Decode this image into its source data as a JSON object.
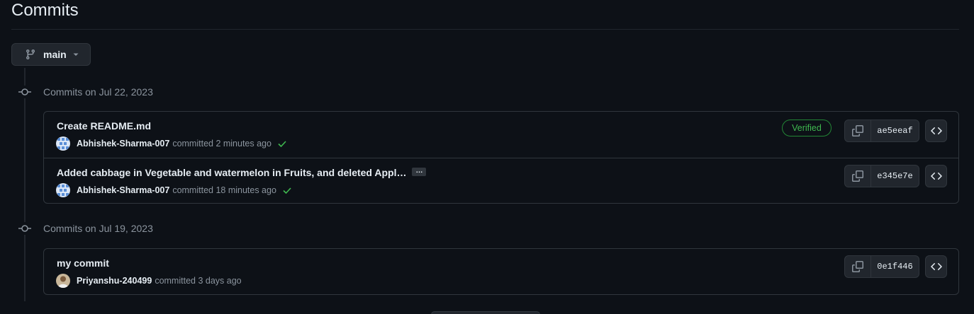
{
  "page": {
    "title": "Commits"
  },
  "branch": {
    "label": "main"
  },
  "groups": [
    {
      "date_label": "Commits on Jul 22, 2023",
      "commits": [
        {
          "message": "Create README.md",
          "author": "Abhishek-Sharma-007",
          "committed_text": "committed 2 minutes ago",
          "verified": "Verified",
          "sha": "ae5eeaf",
          "status": "success"
        },
        {
          "message": "Added cabbage in Vegetable and watermelon in Fruits, and deleted Appl…",
          "ellipsis": "…",
          "author": "Abhishek-Sharma-007",
          "committed_text": "committed 18 minutes ago",
          "sha": "e345e7e",
          "status": "success"
        }
      ]
    },
    {
      "date_label": "Commits on Jul 19, 2023",
      "commits": [
        {
          "message": "my commit",
          "author": "Priyanshu-240499",
          "committed_text": "committed 3 days ago",
          "sha": "0e1f446"
        }
      ]
    }
  ],
  "icons": {
    "branch": "git-branch-icon",
    "caret": "triangle-down-icon",
    "commit": "git-commit-icon",
    "copy": "copy-icon",
    "browse": "code-icon",
    "check": "check-icon"
  },
  "colors": {
    "background": "#0d1117",
    "border": "#30363d",
    "text": "#e6edf3",
    "muted": "#8b949e",
    "success": "#3fb950"
  }
}
